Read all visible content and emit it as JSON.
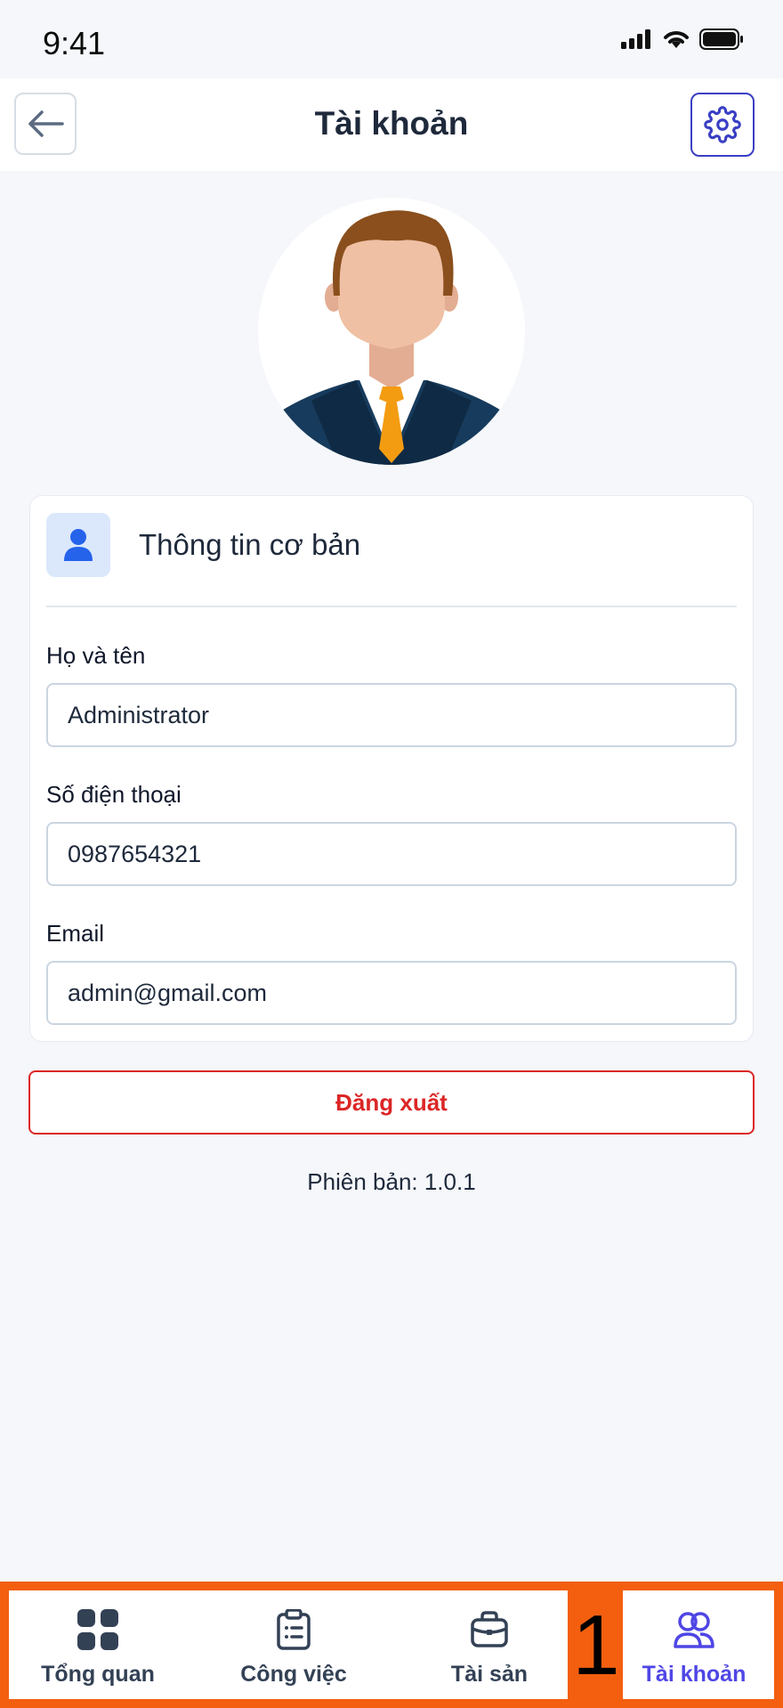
{
  "status_bar": {
    "time": "9:41"
  },
  "header": {
    "title": "Tài khoản"
  },
  "card": {
    "title": "Thông tin cơ bản",
    "fields": [
      {
        "label": "Họ và tên",
        "value": "Administrator"
      },
      {
        "label": "Số điện thoại",
        "value": "0987654321"
      },
      {
        "label": "Email",
        "value": "admin@gmail.com"
      }
    ]
  },
  "logout_label": "Đăng xuất",
  "version_text": "Phiên bản: 1.0.1",
  "bottom_nav": {
    "items": [
      {
        "label": "Tổng quan",
        "icon": "grid-icon"
      },
      {
        "label": "Công việc",
        "icon": "clipboard-list-icon"
      },
      {
        "label": "Tài sản",
        "icon": "briefcase-icon"
      },
      {
        "label": "Tài khoản",
        "icon": "users-icon",
        "active": true
      }
    ],
    "badge": "1"
  },
  "colors": {
    "accent": "#4f46e5",
    "danger": "#dc2626",
    "highlight": "#f35f0f",
    "card_icon_bg": "#dbe8fb",
    "user_icon": "#2563eb"
  }
}
